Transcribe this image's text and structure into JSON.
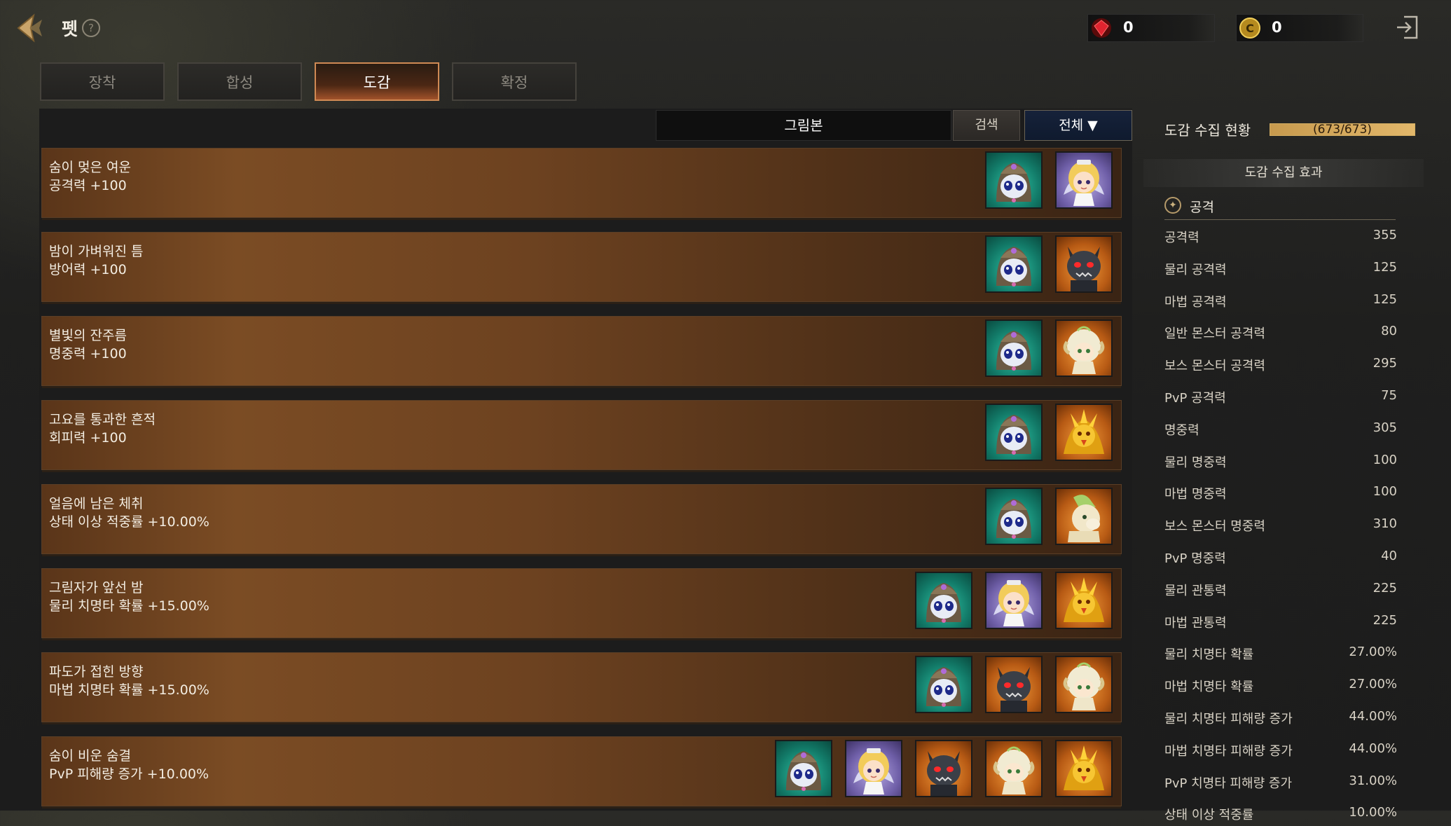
{
  "header": {
    "title": "펫",
    "help": "?",
    "currencies": [
      {
        "icon": "red-gem-icon",
        "value": "0"
      },
      {
        "icon": "gold-coin-icon",
        "value": "0"
      }
    ]
  },
  "tabs": [
    {
      "label": "장착",
      "active": false
    },
    {
      "label": "합성",
      "active": false
    },
    {
      "label": "도감",
      "active": true
    },
    {
      "label": "확정",
      "active": false
    }
  ],
  "toolbar": {
    "grimbon_label": "그림본",
    "search_label": "검색",
    "filter_label": "전체 ▼"
  },
  "collections": [
    {
      "title": "숨이 멎은 여운",
      "effect": "공격력 +100",
      "pets": [
        "ghost-pet",
        "fairy-pet"
      ]
    },
    {
      "title": "밤이 가벼워진 틈",
      "effect": "방어력 +100",
      "pets": [
        "ghost-pet",
        "demon-pet"
      ]
    },
    {
      "title": "별빛의 잔주름",
      "effect": "명중력 +100",
      "pets": [
        "ghost-pet",
        "lamb-pet"
      ]
    },
    {
      "title": "고요를 통과한 흔적",
      "effect": "회피력 +100",
      "pets": [
        "ghost-pet",
        "phoenix-pet"
      ]
    },
    {
      "title": "얼음에 남은 체취",
      "effect": "상태 이상 적중률 +10.00%",
      "pets": [
        "ghost-pet",
        "pony-pet"
      ]
    },
    {
      "title": "그림자가 앞선 밤",
      "effect": "물리 치명타 확률 +15.00%",
      "pets": [
        "ghost-pet",
        "fairy-pet",
        "phoenix-pet"
      ]
    },
    {
      "title": "파도가 접힌 방향",
      "effect": "마법 치명타 확률 +15.00%",
      "pets": [
        "ghost-pet",
        "demon-pet",
        "lamb-pet"
      ]
    },
    {
      "title": "숨이 비운 숨결",
      "effect": "PvP 피해량 증가 +10.00%",
      "pets": [
        "ghost-pet",
        "fairy-pet",
        "demon-pet",
        "lamb-pet",
        "phoenix-pet"
      ]
    }
  ],
  "side": {
    "collect_label": "도감 수집 현황",
    "collect_text": "(673/673)",
    "collect_progress": 1.0,
    "effect_header": "도감 수집 효과",
    "category_label": "공격",
    "stats": [
      {
        "name": "공격력",
        "value": "355"
      },
      {
        "name": "물리 공격력",
        "value": "125"
      },
      {
        "name": "마법 공격력",
        "value": "125"
      },
      {
        "name": "일반 몬스터 공격력",
        "value": "80"
      },
      {
        "name": "보스 몬스터 공격력",
        "value": "295"
      },
      {
        "name": "PvP 공격력",
        "value": "75"
      },
      {
        "name": "명중력",
        "value": "305"
      },
      {
        "name": "물리 명중력",
        "value": "100"
      },
      {
        "name": "마법 명중력",
        "value": "100"
      },
      {
        "name": "보스 몬스터 명중력",
        "value": "310"
      },
      {
        "name": "PvP 명중력",
        "value": "40"
      },
      {
        "name": "물리 관통력",
        "value": "225"
      },
      {
        "name": "마법 관통력",
        "value": "225"
      },
      {
        "name": "물리 치명타 확률",
        "value": "27.00%"
      },
      {
        "name": "마법 치명타 확률",
        "value": "27.00%"
      },
      {
        "name": "물리 치명타 피해량 증가",
        "value": "44.00%"
      },
      {
        "name": "마법 치명타 피해량 증가",
        "value": "44.00%"
      },
      {
        "name": "PvP 치명타 피해량 증가",
        "value": "31.00%"
      },
      {
        "name": "상태 이상 적중률",
        "value": "10.00%"
      }
    ]
  },
  "colors": {
    "accent": "#d08a54",
    "row_brown": "#7b4c24",
    "progress": "#e2b76a"
  }
}
